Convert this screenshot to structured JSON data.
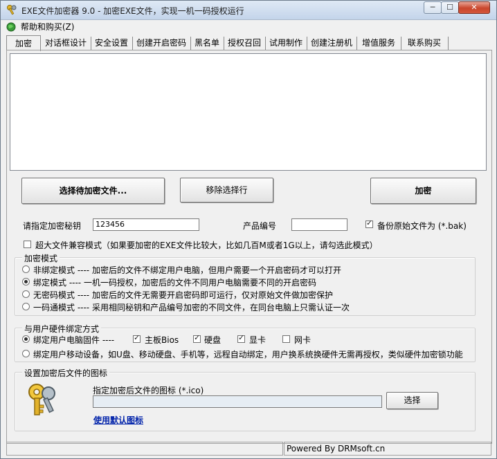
{
  "window": {
    "title": "EXE文件加密器 9.0 - 加密EXE文件，实现一机一码授权运行"
  },
  "window_controls": {
    "minimize": "─",
    "maximize": "☐",
    "close": "✕"
  },
  "menu": {
    "help": "帮助和购买(Z)"
  },
  "tabs": [
    {
      "label": "加密",
      "active": true
    },
    {
      "label": "对话框设计"
    },
    {
      "label": "安全设置"
    },
    {
      "label": "创建开启密码"
    },
    {
      "label": "黑名单"
    },
    {
      "label": "授权召回"
    },
    {
      "label": "试用制作"
    },
    {
      "label": "创建注册机"
    },
    {
      "label": "增值服务"
    },
    {
      "label": "联系购买"
    }
  ],
  "actions": {
    "select_files": "选择待加密文件...",
    "remove_selection": "移除选择行",
    "encrypt": "加密"
  },
  "key_row": {
    "secret_label": "请指定加密秘钥",
    "secret_value": "123456",
    "product_label": "产品编号",
    "product_value": "",
    "backup_label": "备份原始文件为 (*.bak)",
    "backup_checked": true
  },
  "large_file": {
    "label": "超大文件兼容模式（如果要加密的EXE文件比较大，比如几百M或者1G以上，请勾选此模式）",
    "checked": false
  },
  "encrypt_mode": {
    "title": "加密模式",
    "options": [
      {
        "label": "非绑定模式 ---- 加密后的文件不绑定用户电脑，但用户需要一个开启密码才可以打开",
        "selected": false
      },
      {
        "label": "绑定模式 ---- 一机一码授权，加密后的文件不同用户电脑需要不同的开启密码",
        "selected": true
      },
      {
        "label": "无密码模式 ---- 加密后的文件无需要开启密码即可运行，仅对原始文件做加密保护",
        "selected": false
      },
      {
        "label": "一码通模式 ---- 采用相同秘钥和产品编号加密的不同文件，在同台电脑上只需认证一次",
        "selected": false
      }
    ]
  },
  "hardware_bind": {
    "title": "与用户硬件绑定方式",
    "firmware_label": "绑定用户电脑固件 ----",
    "firmware_selected": true,
    "components": [
      {
        "label": "主板Bios",
        "checked": true
      },
      {
        "label": "硬盘",
        "checked": true
      },
      {
        "label": "显卡",
        "checked": true
      },
      {
        "label": "网卡",
        "checked": false
      }
    ],
    "mobile_label": "绑定用户移动设备，如U盘、移动硬盘、手机等，远程自动绑定，用户换系统换硬件无需再授权，类似硬件加密锁功能",
    "mobile_selected": false
  },
  "icon_settings": {
    "title": "设置加密后文件的图标",
    "icon_label": "指定加密后文件的图标 (*.ico)",
    "icon_path": "",
    "select_button": "选择",
    "default_link": "使用默认图标"
  },
  "status": {
    "left": "",
    "right": "Powered By DRMsoft.cn"
  },
  "icons": {
    "app": "keys-icon",
    "menu": "globe-icon",
    "large": "keys-icon"
  }
}
